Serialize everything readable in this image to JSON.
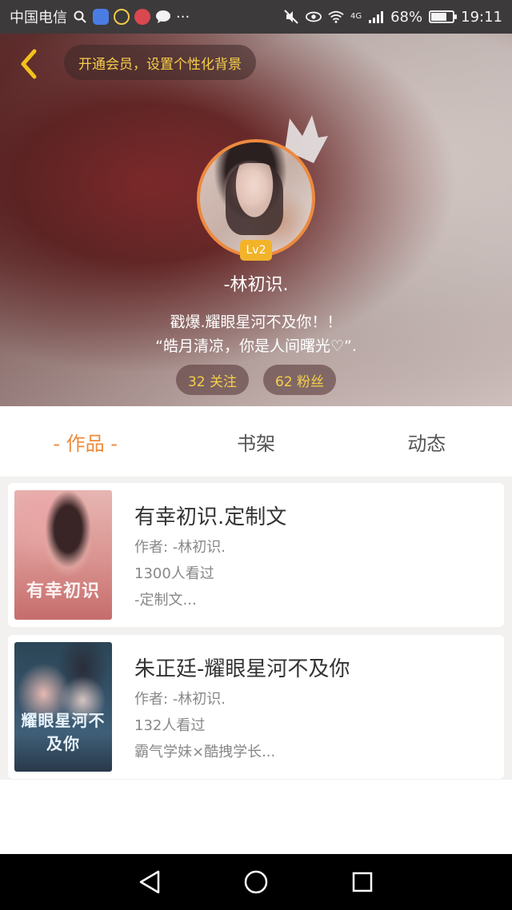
{
  "status_bar": {
    "carrier": "中国电信",
    "network": "4G",
    "battery": "68%",
    "battery_level": 0.68,
    "time": "19:11",
    "icons": [
      "search-icon",
      "paw-app-icon",
      "notification-app-icon",
      "weibo-app-icon",
      "chat-bubble-icon",
      "more-dots-icon",
      "mute-icon",
      "eye-icon",
      "wifi-icon",
      "signal-icon",
      "battery-icon"
    ]
  },
  "header": {
    "vip_prompt": "开通会员，设置个性化背景",
    "level": "Lv2",
    "username": "-林初识.",
    "bio_line1": "戳爆.耀眼星河不及你！！",
    "bio_line2": "“皓月清凉，你是人间曙光♡”.",
    "following": "32 关注",
    "followers": "62 粉丝",
    "accent_color": "#f6cf4b",
    "avatar_border": "#ed8a3f"
  },
  "tabs": [
    {
      "label": "- 作品 -",
      "active": true
    },
    {
      "label": "书架",
      "active": false
    },
    {
      "label": "动态",
      "active": false
    }
  ],
  "books": [
    {
      "title": "有幸初识.定制文",
      "author": "作者: -林初识.",
      "views": "1300人看过",
      "description": "-定制文...",
      "cover_text": "有幸初识"
    },
    {
      "title": "朱正廷-耀眼星河不及你",
      "author": "作者: -林初识.",
      "views": "132人看过",
      "description": "霸气学妹×酷拽学长...",
      "cover_text": "耀眼星河不及你"
    }
  ],
  "nav": [
    "back-triangle-icon",
    "home-circle-icon",
    "recent-square-icon"
  ]
}
